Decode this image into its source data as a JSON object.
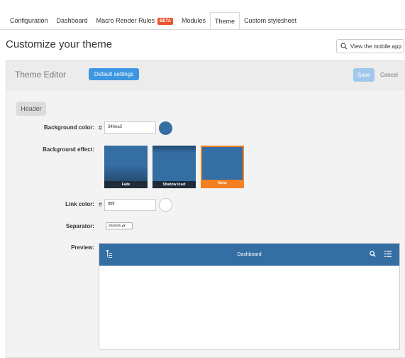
{
  "tabs": [
    {
      "label": "Configuration"
    },
    {
      "label": "Dashboard"
    },
    {
      "label": "Macro Render Rules",
      "badge": "BETA"
    },
    {
      "label": "Modules"
    },
    {
      "label": "Theme",
      "active": true
    },
    {
      "label": "Custom stylesheet"
    }
  ],
  "page": {
    "title": "Customize your theme",
    "mobile_button": "View the mobile app"
  },
  "editor": {
    "title": "Theme Editor",
    "default_button": "Default settings",
    "save_button": "Save",
    "cancel_link": "Cancel"
  },
  "section": {
    "header": "Header"
  },
  "fields": {
    "bg_color_label": "Background color:",
    "hash": "#",
    "bg_color_value": "346ea3",
    "bg_color_swatch": "#346ea3",
    "bg_effect_label": "Background effect:",
    "effects": [
      {
        "label": "Fade",
        "selected": false
      },
      {
        "label": "Shadow Inset",
        "selected": false
      },
      {
        "label": "None",
        "selected": true
      }
    ],
    "link_color_label": "Link color:",
    "link_color_value": "ffffff",
    "link_color_swatch": "#ffffff",
    "separator_label": "Separator:",
    "separator_value": "shadow",
    "preview_label": "Preview:"
  },
  "preview": {
    "title": "Dashboard"
  },
  "colors": {
    "accent": "#346ea3",
    "selected_effect": "#f48022",
    "beta": "#e8552a"
  },
  "icons": [
    "search-icon",
    "menu-icon",
    "list-icon",
    "tree-icon"
  ]
}
